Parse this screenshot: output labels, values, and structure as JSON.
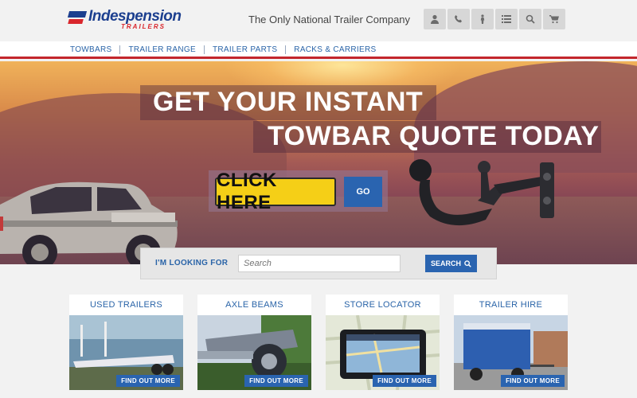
{
  "header": {
    "logo_text": "Indespension",
    "logo_sub": "TRAILERS",
    "tagline": "The Only National Trailer Company",
    "icons": [
      "user-icon",
      "phone-icon",
      "person-icon",
      "list-icon",
      "search-icon",
      "cart-icon"
    ]
  },
  "nav": {
    "items": [
      {
        "label": "TOWBARS"
      },
      {
        "label": "TRAILER RANGE"
      },
      {
        "label": "TRAILER PARTS"
      },
      {
        "label": "RACKS & CARRIERS"
      }
    ]
  },
  "hero": {
    "headline_line1": "GET YOUR INSTANT",
    "headline_line2": "TOWBAR QUOTE TODAY",
    "cta_label": "CLICK HERE",
    "go_label": "GO"
  },
  "search": {
    "label": "I'M LOOKING FOR",
    "placeholder": "Search",
    "button_label": "SEARCH"
  },
  "cards": [
    {
      "title": "USED TRAILERS",
      "button": "FIND OUT MORE"
    },
    {
      "title": "AXLE BEAMS",
      "button": "FIND OUT MORE"
    },
    {
      "title": "STORE LOCATOR",
      "button": "FIND OUT MORE"
    },
    {
      "title": "TRAILER HIRE",
      "button": "FIND OUT MORE"
    }
  ],
  "colors": {
    "brand_blue": "#1c3f8f",
    "link_blue": "#2a64a8",
    "button_blue": "#2a64b0",
    "accent_red": "#c3262c",
    "cta_yellow": "#f5cf17"
  }
}
